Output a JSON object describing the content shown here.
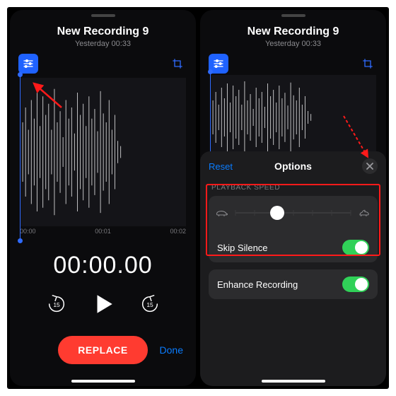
{
  "left": {
    "title": "New Recording 9",
    "subtitle": "Yesterday  00:33",
    "ticks": [
      "00:00",
      "00:01",
      "00:02"
    ],
    "time": "00:00.00",
    "skip_back_amount": "15",
    "skip_fwd_amount": "15",
    "replace_label": "REPLACE",
    "done_label": "Done"
  },
  "right": {
    "title": "New Recording 9",
    "subtitle": "Yesterday  00:33",
    "options": {
      "reset_label": "Reset",
      "title": "Options",
      "section_label": "PLAYBACK SPEED",
      "skip_silence_label": "Skip Silence",
      "enhance_label": "Enhance Recording",
      "skip_silence_on": true,
      "enhance_on": true,
      "speed_position_pct": 36
    }
  },
  "icons": {
    "options": "options-icon",
    "crop": "crop-icon",
    "play": "play-icon",
    "skip_back": "skip-back-15-icon",
    "skip_fwd": "skip-forward-15-icon",
    "turtle": "turtle-icon",
    "rabbit": "rabbit-icon",
    "close": "close-icon"
  },
  "colors": {
    "accent": "#1f62ff",
    "destructive": "#ff3b30",
    "link": "#0a7cff",
    "toggle": "#30d158"
  }
}
